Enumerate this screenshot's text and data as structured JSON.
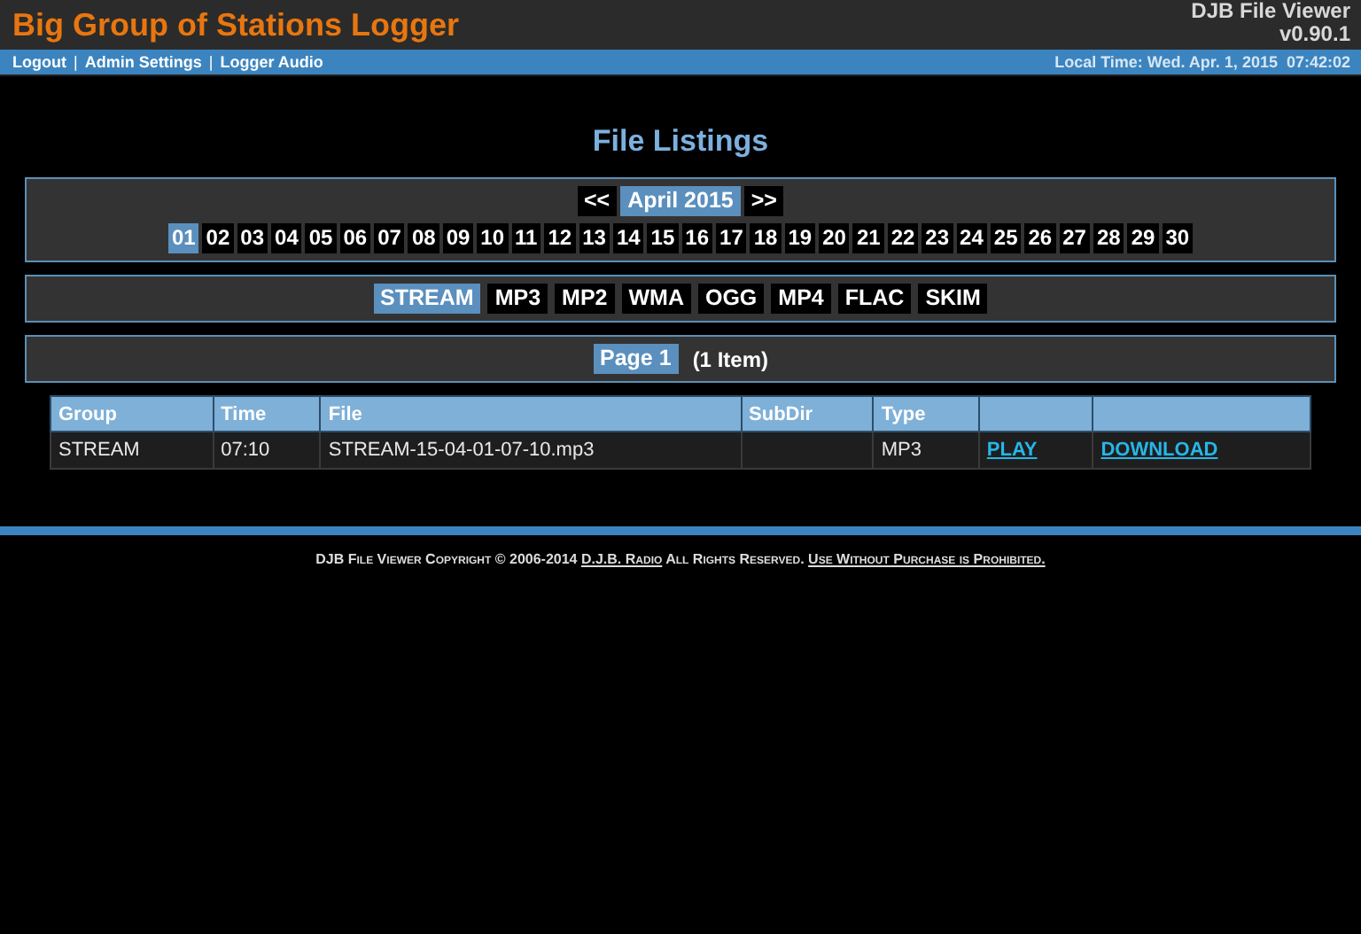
{
  "header": {
    "title": "Big Group of Stations Logger",
    "app_name": "DJB File Viewer",
    "version": "v0.90.1"
  },
  "nav": {
    "links": [
      "Logout",
      "Admin Settings",
      "Logger Audio"
    ],
    "separator": "|",
    "local_time": "Local Time: Wed. Apr. 1, 2015  07:42:02"
  },
  "heading": "File Listings",
  "month_nav": {
    "prev": "<<",
    "month": "April 2015",
    "next": ">>"
  },
  "days": [
    {
      "label": "01",
      "selected": true
    },
    {
      "label": "02",
      "selected": false
    },
    {
      "label": "03",
      "selected": false
    },
    {
      "label": "04",
      "selected": false
    },
    {
      "label": "05",
      "selected": false
    },
    {
      "label": "06",
      "selected": false
    },
    {
      "label": "07",
      "selected": false
    },
    {
      "label": "08",
      "selected": false
    },
    {
      "label": "09",
      "selected": false
    },
    {
      "label": "10",
      "selected": false
    },
    {
      "label": "11",
      "selected": false
    },
    {
      "label": "12",
      "selected": false
    },
    {
      "label": "13",
      "selected": false
    },
    {
      "label": "14",
      "selected": false
    },
    {
      "label": "15",
      "selected": false
    },
    {
      "label": "16",
      "selected": false
    },
    {
      "label": "17",
      "selected": false
    },
    {
      "label": "18",
      "selected": false
    },
    {
      "label": "19",
      "selected": false
    },
    {
      "label": "20",
      "selected": false
    },
    {
      "label": "21",
      "selected": false
    },
    {
      "label": "22",
      "selected": false
    },
    {
      "label": "23",
      "selected": false
    },
    {
      "label": "24",
      "selected": false
    },
    {
      "label": "25",
      "selected": false
    },
    {
      "label": "26",
      "selected": false
    },
    {
      "label": "27",
      "selected": false
    },
    {
      "label": "28",
      "selected": false
    },
    {
      "label": "29",
      "selected": false
    },
    {
      "label": "30",
      "selected": false
    }
  ],
  "formats": [
    {
      "label": "STREAM",
      "selected": true
    },
    {
      "label": "MP3",
      "selected": false
    },
    {
      "label": "MP2",
      "selected": false
    },
    {
      "label": "WMA",
      "selected": false
    },
    {
      "label": "OGG",
      "selected": false
    },
    {
      "label": "MP4",
      "selected": false
    },
    {
      "label": "FLAC",
      "selected": false
    },
    {
      "label": "SKIM",
      "selected": false
    }
  ],
  "pages": [
    {
      "label": "Page 1",
      "selected": true
    }
  ],
  "item_count": "(1 Item)",
  "table": {
    "columns": [
      "Group",
      "Time",
      "File",
      "SubDir",
      "Type",
      "",
      ""
    ],
    "rows": [
      {
        "group": "STREAM",
        "time": "07:10",
        "file": "STREAM-15-04-01-07-10.mp3",
        "subdir": "",
        "type": "MP3",
        "play": "PLAY",
        "download": "DOWNLOAD"
      }
    ]
  },
  "footer": {
    "text_before": "DJB File Viewer Copyright © 2006-2014 ",
    "link_radio": "D.J.B. Radio",
    "text_middle": " All Rights Reserved. ",
    "link_terms": "Use Without Purchase is Prohibited."
  }
}
